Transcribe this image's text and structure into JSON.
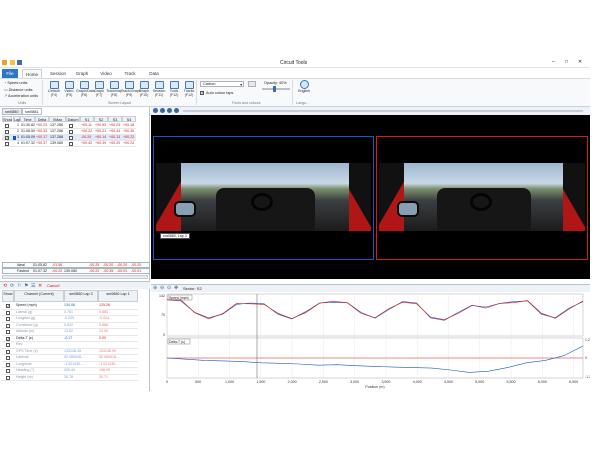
{
  "app": {
    "title": "Circuit Tools"
  },
  "ribbon": {
    "file_label": "File",
    "tabs": [
      "Home",
      "Session",
      "Graph",
      "Video",
      "Track",
      "Data"
    ],
    "units": {
      "speed": "Speed units",
      "distance": "Distance units",
      "accel": "Acceleration units",
      "group": "Units"
    },
    "layout_buttons": [
      {
        "label": "Default",
        "key": "(F4)"
      },
      {
        "label": "Video",
        "key": "(F5)"
      },
      {
        "label": "Graph/Data",
        "key": "(F6)"
      },
      {
        "label": "Graph",
        "key": "(F7)"
      },
      {
        "label": "Trackmap",
        "key": "(F8)"
      },
      {
        "label": "Track/Graph",
        "key": "(F9)"
      },
      {
        "label": "Graph",
        "key": "(F10)"
      },
      {
        "label": "Session",
        "key": "(F11)"
      },
      {
        "label": "Tools",
        "key": "(F12)"
      },
      {
        "label": "Tracks",
        "key": "(F12)"
      }
    ],
    "layout_group": "Screen Layout",
    "colour_value": "Carbon",
    "opacity_label": "Opacity: 40%",
    "auto_colour": "Auto colour laps",
    "fonts_group": "Fonts and colours",
    "lang_label": "English",
    "lang_group": "Langu..."
  },
  "laps_panel": {
    "tabs": [
      "sm0880",
      "sm0881"
    ],
    "headers": [
      "Show",
      "Lap",
      "Time",
      "Delta",
      "VMax",
      "Datum",
      "S1",
      "S2",
      "S3",
      "S4"
    ],
    "rows": [
      {
        "lap": "1",
        "time": "01:30.82",
        "delta": "+00.23",
        "vmax": "137.288",
        "s1": "+00.11",
        "s2": "+00.53",
        "s3": "+00.23",
        "s4": "+00.18"
      },
      {
        "lap": "2",
        "time": "01:08.50",
        "delta": "+00.33",
        "vmax": "137.288",
        "s1": "+00.22",
        "s2": "+00.21",
        "s3": "+00.44",
        "s4": "+00.30"
      },
      {
        "lap": "3",
        "time": "01:05.09",
        "delta": "+00.17",
        "vmax": "137.288",
        "s1": "-00.29",
        "s2": "+00.14",
        "s3": "+00.13",
        "s4": "+00.22"
      },
      {
        "lap": "4",
        "time": "01:07.32",
        "delta": "+00.37",
        "vmax": "139.080",
        "s1": "+00.42",
        "s2": "+00.39",
        "s3": "+00.20",
        "s4": "+00.24"
      }
    ],
    "ideal": {
      "label": "Ideal",
      "time": "01:05.82",
      "delta": "-01.56",
      "s1": "-00.25",
      "s2": "-00.20",
      "s3": "-00.20",
      "s4": "-00.20"
    },
    "fastest": {
      "label": "Fastest",
      "time": "01:07.32",
      "delta": "-00.22",
      "vmax": "139.080",
      "s1": "-00.22",
      "s2": "-00.35",
      "s3": "-00.01",
      "s4": "-00.01"
    }
  },
  "channels_panel": {
    "toolbar_label": "Cancel",
    "headers": [
      "Show",
      "Channel (Current)",
      "sm0880 Lap 3",
      "sm0880 Lap 1"
    ],
    "rows": [
      {
        "show": true,
        "name": "Speed (mph)",
        "v1": "134.06",
        "v2": "125.26"
      },
      {
        "show": false,
        "name": "Lateral (g)",
        "v1": "0.761",
        "v2": "0.883"
      },
      {
        "show": false,
        "name": "Longitud (g)",
        "v1": "-0.029",
        "v2": "-0.004"
      },
      {
        "show": false,
        "name": "Combined (g)",
        "v1": "0.822",
        "v2": "0.886"
      },
      {
        "show": false,
        "name": "Altitude (m)",
        "v1": "13.52",
        "v2": "13.50"
      },
      {
        "show": true,
        "name": "Delta-T (s)",
        "v1": "-0.17",
        "v2": "0.00"
      },
      {
        "show": false,
        "name": "Rev",
        "v1": "",
        "v2": ""
      },
      {
        "show": false,
        "name": "GPS Time (s)",
        "v1": "133148.45",
        "v2": "133148.90"
      },
      {
        "show": false,
        "name": "Latitude",
        "v1": "52.069416...",
        "v2": "52.069416..."
      },
      {
        "show": false,
        "name": "Longitude",
        "v1": "-1.021430...",
        "v2": "-1.021430..."
      },
      {
        "show": false,
        "name": "Heading (°)",
        "v1": "200.44",
        "v2": "198.99"
      },
      {
        "show": false,
        "name": "Height (m)",
        "v1": "30.78",
        "v2": "30.71"
      }
    ]
  },
  "video": {
    "left_label": "sm0880, Lap 3"
  },
  "graph": {
    "sector_label": "Sector: S2",
    "speed_box": "Speed (mph)",
    "delta_box": "Delta-T (s)",
    "y_top": "142",
    "y_mid": "70",
    "y_bot": "0",
    "dy_top": "1.299",
    "dy_mid": "0",
    "dy_bot": "-1.299",
    "xlabel": "Position (m)",
    "xticks": [
      "0",
      "500",
      "1,000",
      "1,500",
      "2,000",
      "2,500",
      "3,000",
      "3,500",
      "4,000",
      "4,500",
      "5,000",
      "5,500",
      "6,000",
      "6,500"
    ]
  },
  "colors": {
    "accent": "#2b78c5",
    "red": "#d51b1b",
    "blue": "#1557c2"
  }
}
